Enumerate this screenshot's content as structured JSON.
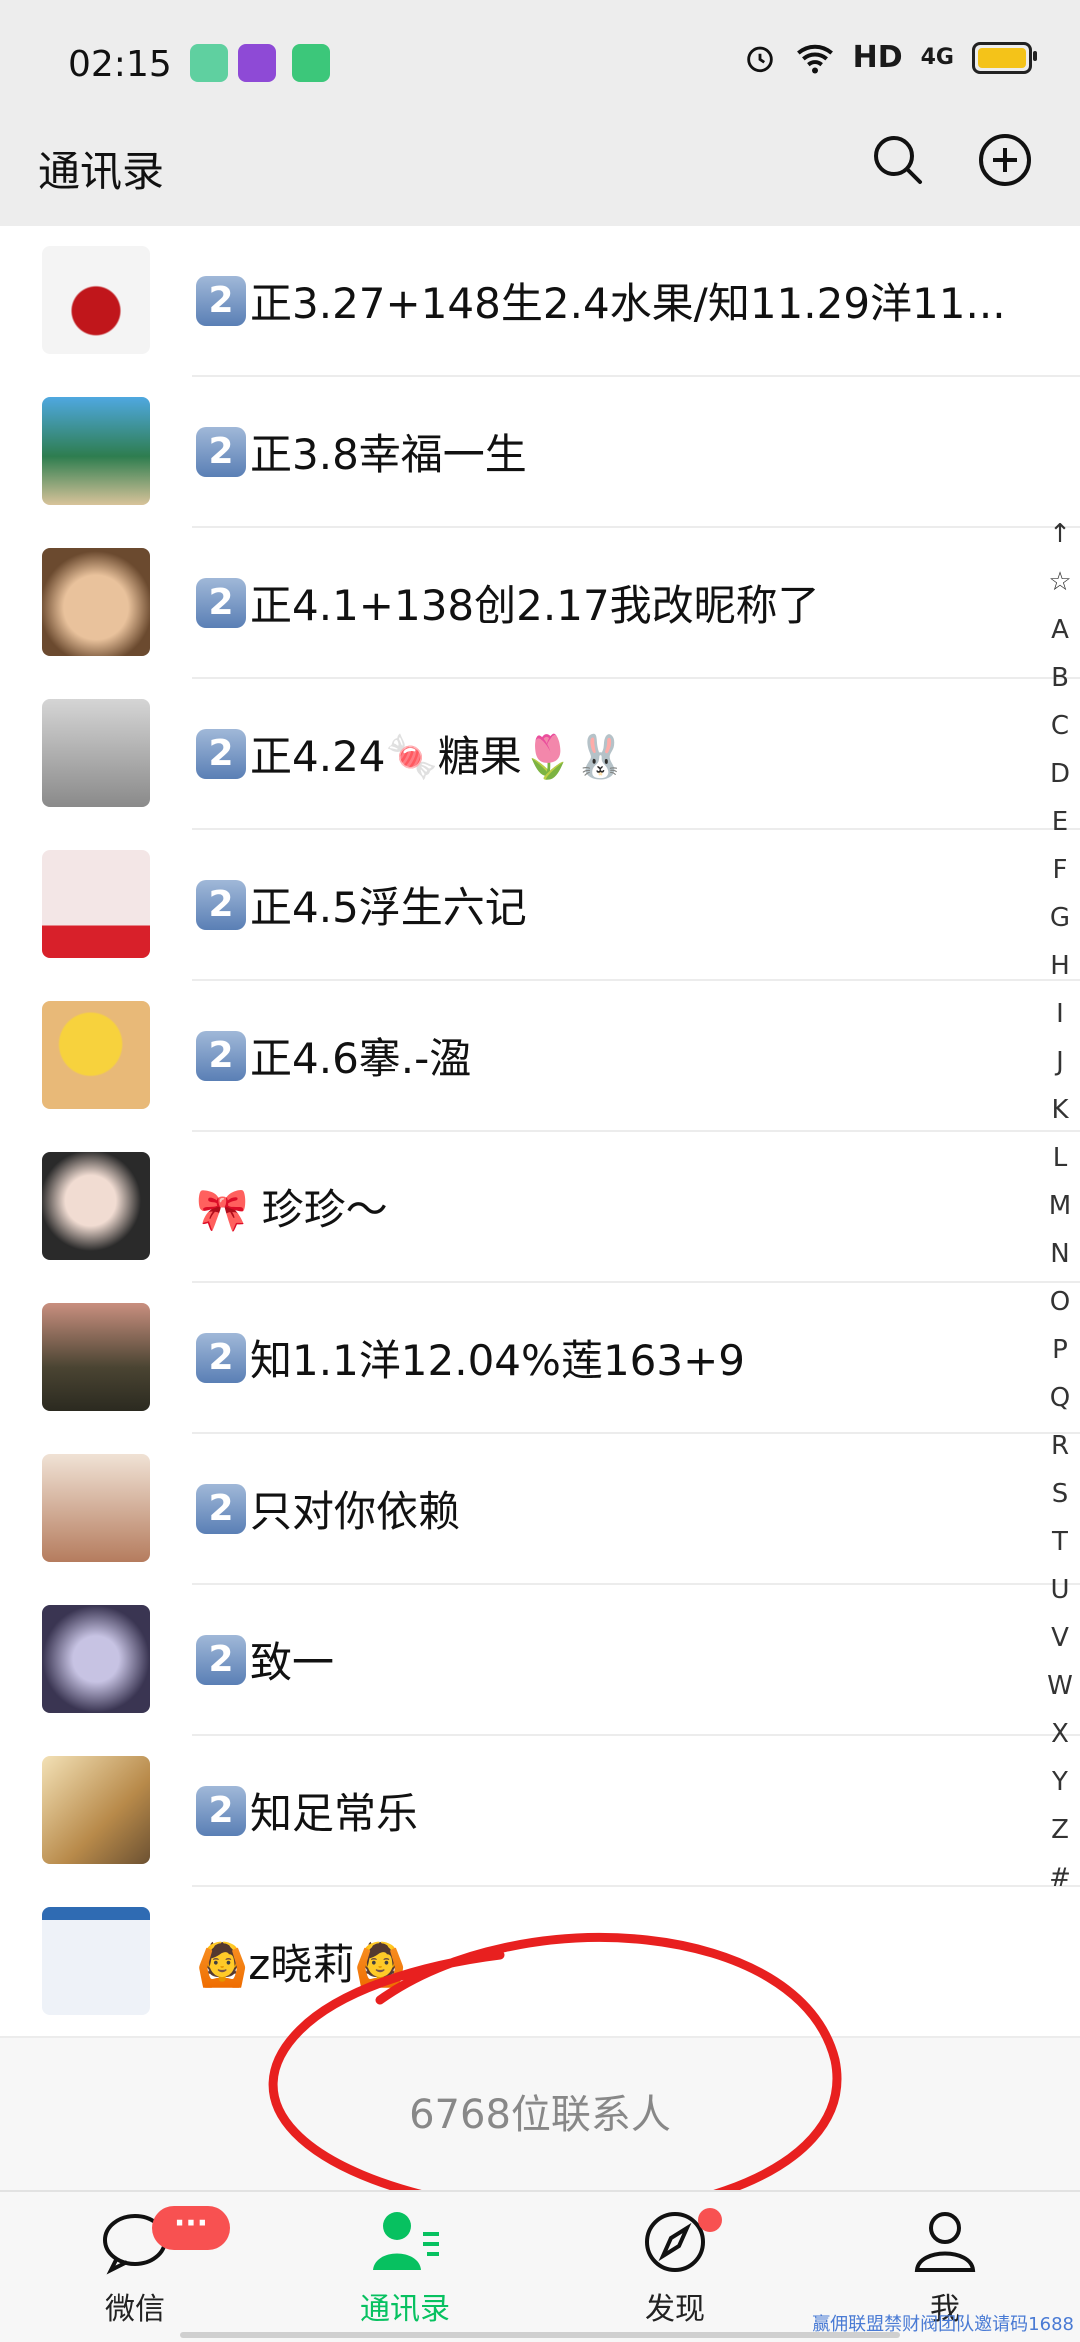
{
  "status_bar": {
    "time": "02:15",
    "network_label": "HD",
    "signal_label": "4G",
    "colors": {
      "battery": "#f4c319"
    }
  },
  "header": {
    "title": "通讯录",
    "icons": [
      "search-icon",
      "add-circle-icon"
    ]
  },
  "contacts": [
    {
      "badge": "2",
      "name": "正3.27+148生2.4水果/知11.29洋11..."
    },
    {
      "badge": "2",
      "name": "正3.8幸福一生"
    },
    {
      "badge": "2",
      "name": "正4.1+138创2.17我改昵称了"
    },
    {
      "badge": "2",
      "name": "正4.24🍬糖果🌷🐰"
    },
    {
      "badge": "2",
      "name": "正4.5浮生六记"
    },
    {
      "badge": "2",
      "name": "正4.6搴.-溋"
    },
    {
      "badge": "",
      "name": "🎀 珍珍～"
    },
    {
      "badge": "2",
      "name": "知1.1洋12.04%莲163+9"
    },
    {
      "badge": "2",
      "name": "只对你依赖"
    },
    {
      "badge": "2",
      "name": "致一"
    },
    {
      "badge": "2",
      "name": "知足常乐"
    },
    {
      "badge": "",
      "name": "🙆z晓莉🙆"
    }
  ],
  "index_bar": [
    "↑",
    "☆",
    "A",
    "B",
    "C",
    "D",
    "E",
    "F",
    "G",
    "H",
    "I",
    "J",
    "K",
    "L",
    "M",
    "N",
    "O",
    "P",
    "Q",
    "R",
    "S",
    "T",
    "U",
    "V",
    "W",
    "X",
    "Y",
    "Z",
    "#"
  ],
  "footer": {
    "count_text": "6768位联系人"
  },
  "tabs": [
    {
      "label": "微信",
      "icon": "chat-bubble-icon",
      "badge": "···"
    },
    {
      "label": "通讯录",
      "icon": "contacts-icon",
      "active": true
    },
    {
      "label": "发现",
      "icon": "compass-icon"
    },
    {
      "label": "我",
      "icon": "person-icon"
    }
  ],
  "watermark": "赢佣联盟禁财阀团队邀请码1688",
  "colors": {
    "accent": "#07c160",
    "badge_red": "#f85151",
    "annotation_red": "#e8201f"
  }
}
